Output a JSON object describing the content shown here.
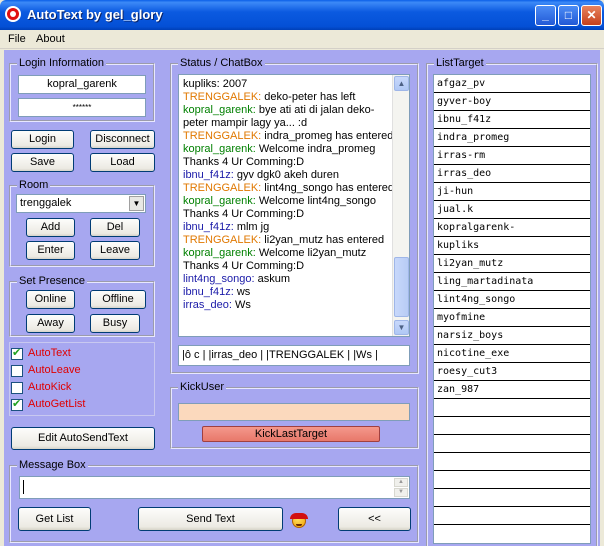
{
  "window": {
    "title": "AutoText by gel_glory"
  },
  "menu": [
    "File",
    "About"
  ],
  "login": {
    "title": "Login Information",
    "username": "kopral_garenk",
    "password": "******",
    "buttons": {
      "login": "Login",
      "disconnect": "Disconnect",
      "save": "Save",
      "load": "Load"
    }
  },
  "room": {
    "title": "Room",
    "selected": "trenggalek",
    "buttons": {
      "add": "Add",
      "del": "Del",
      "enter": "Enter",
      "leave": "Leave"
    }
  },
  "presence": {
    "title": "Set Presence",
    "buttons": {
      "online": "Online",
      "offline": "Offline",
      "away": "Away",
      "busy": "Busy"
    }
  },
  "options": [
    {
      "label": "AutoText",
      "checked": true
    },
    {
      "label": "AutoLeave",
      "checked": false
    },
    {
      "label": "AutoKick",
      "checked": false
    },
    {
      "label": "AutoGetList",
      "checked": true
    }
  ],
  "edit_autosend": "Edit AutoSendText",
  "status": {
    "title": "Status / ChatBox",
    "lines": [
      {
        "name": "kupliks:",
        "text": " 2007",
        "color": "black"
      },
      {
        "name": "TRENGGALEK:",
        "text": " deko-peter has left",
        "color": "orange"
      },
      {
        "name": "kopral_garenk:",
        "text": " bye ati ati di jalan deko-",
        "color": "green"
      },
      {
        "name": "",
        "text": "peter mampir lagy ya... :d",
        "color": "black"
      },
      {
        "name": "TRENGGALEK:",
        "text": " indra_promeg has entered",
        "color": "orange"
      },
      {
        "name": "kopral_garenk:",
        "text": " Welcome indra_promeg",
        "color": "green"
      },
      {
        "name": "",
        "text": "Thanks 4 Ur Comming:D",
        "color": "black"
      },
      {
        "name": "ibnu_f41z:",
        "text": " gyv dgk0 akeh duren",
        "color": "blue"
      },
      {
        "name": "TRENGGALEK:",
        "text": " lint4ng_songo has entered",
        "color": "orange"
      },
      {
        "name": "kopral_garenk:",
        "text": " Welcome lint4ng_songo",
        "color": "green"
      },
      {
        "name": "",
        "text": "Thanks 4 Ur Comming:D",
        "color": "black"
      },
      {
        "name": "ibnu_f41z:",
        "text": " mlm jg",
        "color": "blue"
      },
      {
        "name": "TRENGGALEK:",
        "text": " li2yan_mutz has entered",
        "color": "orange"
      },
      {
        "name": "kopral_garenk:",
        "text": " Welcome li2yan_mutz",
        "color": "green"
      },
      {
        "name": "",
        "text": "Thanks 4 Ur Comming:D",
        "color": "black"
      },
      {
        "name": "lint4ng_songo:",
        "text": " askum",
        "color": "blue"
      },
      {
        "name": "ibnu_f41z:",
        "text": " ws",
        "color": "blue"
      },
      {
        "name": "irras_deo:",
        "text": " Ws",
        "color": "blue"
      }
    ],
    "users_bar": "|ô    c  |  |irras_deo  |  |TRENGGALEK  |   |Ws  |"
  },
  "kick": {
    "title": "KickUser",
    "button": "KickLastTarget"
  },
  "message": {
    "title": "Message Box",
    "buttons": {
      "get_list": "Get List",
      "send_text": "Send Text",
      "back": "<<"
    }
  },
  "list_target": {
    "title": "ListTarget",
    "items": [
      "afgaz_pv",
      "gyver-boy",
      "ibnu_f41z",
      "indra_promeg",
      "irras-rm",
      "irras_deo",
      "ji-hun",
      "jual.k",
      "kopralgarenk-",
      "kupliks",
      "li2yan_mutz",
      "ling_martadinata",
      "lint4ng_songo",
      "myofmine",
      "narsiz_boys",
      "nicotine_exe",
      "roesy_cut3",
      "zan_987",
      "",
      "",
      "",
      "",
      "",
      "",
      ""
    ]
  },
  "colors": {
    "orange": "#e07800",
    "green": "#008000",
    "blue": "#1a1aa8",
    "black": "#000000"
  }
}
